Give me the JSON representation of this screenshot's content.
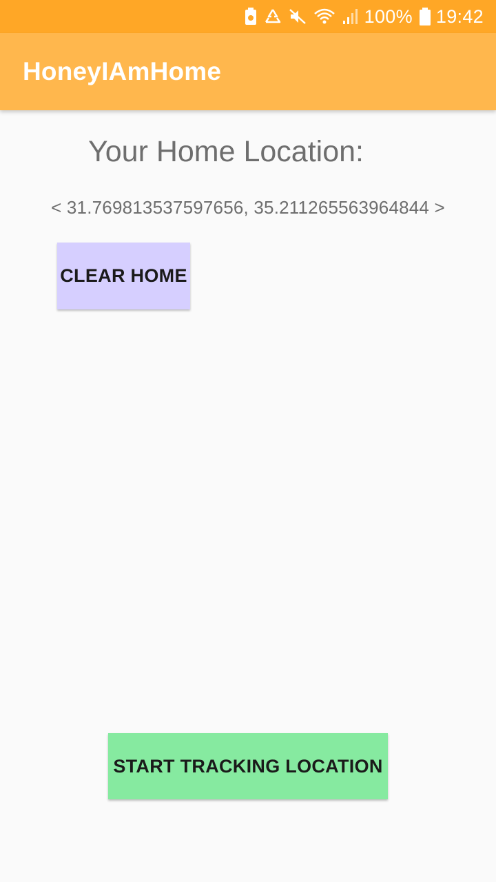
{
  "status_bar": {
    "battery_percent": "100%",
    "time": "19:42",
    "icons": [
      "battery-saver-icon",
      "recycle-icon",
      "mute-icon",
      "wifi-icon",
      "signal-icon",
      "battery-icon"
    ]
  },
  "app_bar": {
    "title": "HoneyIAmHome"
  },
  "main": {
    "heading": "Your Home Location:",
    "coordinates": "< 31.769813537597656, 35.211265563964844 >",
    "clear_button_label": "CLEAR HOME",
    "track_button_label": "START TRACKING LOCATION"
  },
  "colors": {
    "status_bar": "#ffa726",
    "app_bar": "#ffb74d",
    "clear_button": "#d6cfff",
    "track_button": "#86eaa0",
    "text_gray": "#6e6e6e"
  }
}
